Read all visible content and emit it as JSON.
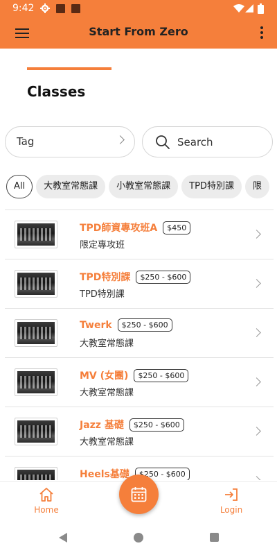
{
  "status_bar": {
    "time": "9:42"
  },
  "app_bar": {
    "title": "Start From Zero"
  },
  "page": {
    "title": "Classes"
  },
  "filters": {
    "tag_label": "Tag",
    "search_placeholder": "Search"
  },
  "chips": [
    "All",
    "大教室常態課",
    "小教室常態課",
    "TPD特別課",
    "限"
  ],
  "classes": [
    {
      "name": "TPD師資專攻班A",
      "price": "$450",
      "category": "限定專攻班"
    },
    {
      "name": "TPD特別課",
      "price": "$250 - $600",
      "category": "TPD特別課"
    },
    {
      "name": "Twerk",
      "price": "$250 - $600",
      "category": "大教室常態課"
    },
    {
      "name": "MV (女團)",
      "price": "$250 - $600",
      "category": "大教室常態課"
    },
    {
      "name": "Jazz 基礎",
      "price": "$250 - $600",
      "category": "大教室常態課"
    },
    {
      "name": "Heels基礎",
      "price": "$250 - $600",
      "category": ""
    }
  ],
  "bottom_nav": {
    "home_label": "Home",
    "login_label": "Login"
  },
  "colors": {
    "accent": "#f57f3b",
    "app_bar_text": "#222222"
  },
  "icons": {
    "menu": "hamburger-icon",
    "more": "more-vert-icon",
    "tag_chevron": "chevron-right-icon",
    "search": "search-icon",
    "home": "home-icon",
    "calendar": "calendar-icon",
    "login": "login-icon"
  }
}
